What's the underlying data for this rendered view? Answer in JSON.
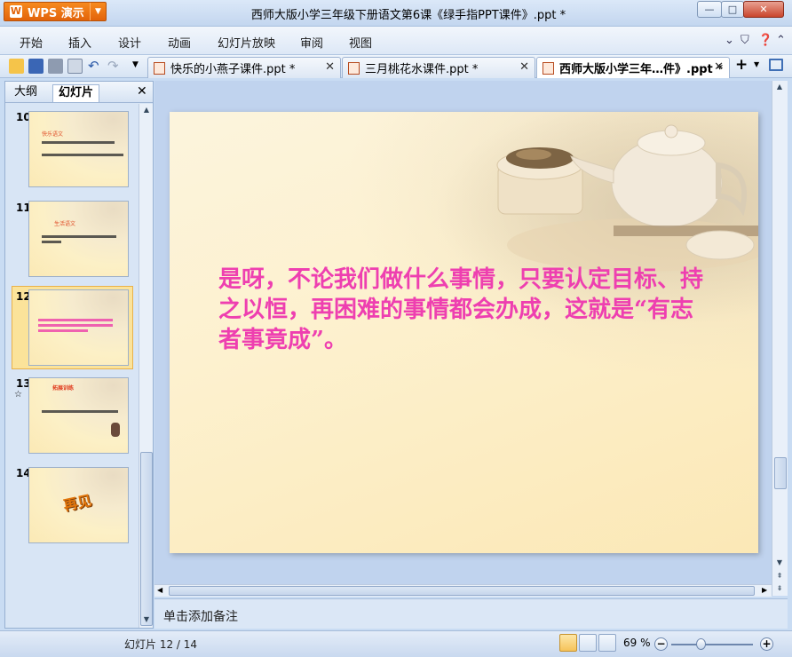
{
  "app": {
    "logo_label": "WPS 演示",
    "title": "西师大版小学三年级下册语文第6课《绿手指PPT课件》.ppt *"
  },
  "menu": {
    "items": [
      "开始",
      "插入",
      "设计",
      "动画",
      "幻灯片放映",
      "审阅",
      "视图"
    ]
  },
  "tabs": [
    {
      "label": "快乐的小燕子课件.ppt *",
      "active": false
    },
    {
      "label": "三月桃花水课件.ppt *",
      "active": false
    },
    {
      "label": "西师大版小学三年…件》.ppt *",
      "active": true
    }
  ],
  "panel": {
    "tab_outline": "大纲",
    "tab_slides": "幻灯片",
    "close": "✕"
  },
  "thumbnails": [
    {
      "number": "10",
      "title": "快乐语文"
    },
    {
      "number": "11",
      "title": "生活语文"
    },
    {
      "number": "12",
      "title": ""
    },
    {
      "number": "13",
      "title": "拓展训练"
    },
    {
      "number": "14",
      "title": "再见"
    }
  ],
  "slide": {
    "text": "是呀，不论我们做什么事情，只要认定目标、持之以恒，再困难的事情都会办成，这就是“有志者事竟成”。"
  },
  "notes": {
    "placeholder": "单击添加备注"
  },
  "status": {
    "slide_counter": "幻灯片 12 / 14",
    "zoom": "69 %",
    "zoom_fraction": 0.69
  },
  "colors": {
    "slide_text": "#ee3fb0",
    "logo_bg": "#f07a15"
  }
}
